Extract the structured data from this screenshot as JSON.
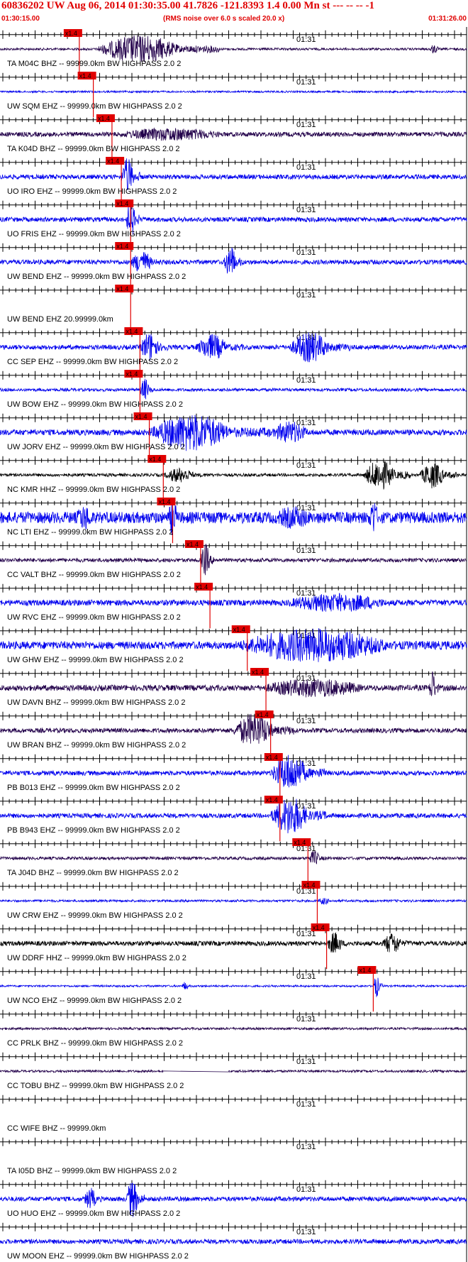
{
  "header": {
    "title": "60836202 UW Aug 06, 2014 01:30:35.00   41.7826 -121.8393  1.4 0.00 Mn st --- -- --  -1",
    "start_time": "01:30:15.00",
    "scale_note": "(RMS noise over 6.0 s scaled 20.0 x)",
    "end_time": "01:31:26.00"
  },
  "tick_label": "01:31",
  "pick_label": "x1.4",
  "colors": {
    "blue": "#0000ee",
    "navy": "#22004a",
    "black": "#000000",
    "red": "#e00000"
  },
  "traces": [
    {
      "label": "TA M04C BHZ -- 99999.0km BW  HIGHPASS  2.0  2",
      "color": "navy",
      "pick": 0.17,
      "amp": 0.06,
      "bursts": [
        [
          0.21,
          0.47,
          0.75
        ],
        [
          0.92,
          0.95,
          0.25
        ]
      ]
    },
    {
      "label": "UW SQM EHZ -- 99999.0km BW  HIGHPASS  2.0  2",
      "color": "blue",
      "pick": 0.2,
      "amp": 0.05,
      "bursts": []
    },
    {
      "label": "TA K04D BHZ -- 99999.0km BW  HIGHPASS  2.0  2",
      "color": "navy",
      "pick": 0.24,
      "amp": 0.12,
      "bursts": [
        [
          0.24,
          0.6,
          0.35
        ]
      ]
    },
    {
      "label": "UO IRO EHZ -- 99999.0km BW  HIGHPASS  2.0  2",
      "color": "blue",
      "pick": 0.26,
      "amp": 0.12,
      "bursts": [
        [
          0.26,
          0.3,
          1.0
        ]
      ]
    },
    {
      "label": "UO FRIS EHZ -- 99999.0km BW  HIGHPASS  2.0  2",
      "color": "blue",
      "pick": 0.28,
      "amp": 0.12,
      "bursts": [
        [
          0.27,
          0.3,
          1.0
        ]
      ]
    },
    {
      "label": "UW BEND EHZ -- 99999.0km BW  HIGHPASS  2.0  2",
      "color": "blue",
      "pick": 0.28,
      "amp": 0.12,
      "bursts": [
        [
          0.28,
          0.35,
          0.6
        ],
        [
          0.48,
          0.52,
          0.9
        ]
      ]
    },
    {
      "label": "UW BEND EHZ 20.99999.0km",
      "color": "none",
      "pick": 0.28,
      "amp": 0,
      "bursts": []
    },
    {
      "label": "CC SEP EHZ -- 99999.0km BW  HIGHPASS  2.0  2",
      "color": "blue",
      "pick": 0.3,
      "amp": 0.12,
      "bursts": [
        [
          0.3,
          0.36,
          0.8
        ],
        [
          0.42,
          0.52,
          0.7
        ],
        [
          0.62,
          0.75,
          0.8
        ]
      ]
    },
    {
      "label": "UW BOW EHZ -- 99999.0km BW  HIGHPASS  2.0  2",
      "color": "blue",
      "pick": 0.3,
      "amp": 0.08,
      "bursts": [
        [
          0.3,
          0.33,
          0.6
        ]
      ]
    },
    {
      "label": "UW JORV EHZ -- 99999.0km BW  HIGHPASS  2.0  2",
      "color": "blue",
      "pick": 0.32,
      "amp": 0.15,
      "bursts": [
        [
          0.32,
          0.58,
          1.0
        ],
        [
          0.58,
          0.7,
          0.6
        ]
      ]
    },
    {
      "label": "NC KMR HHZ -- 99999.0km BW  HIGHPASS  2.0  2",
      "color": "black",
      "pick": 0.35,
      "amp": 0.08,
      "bursts": [
        [
          0.35,
          0.45,
          0.4
        ],
        [
          0.78,
          0.88,
          0.8
        ],
        [
          0.9,
          0.98,
          0.7
        ]
      ]
    },
    {
      "label": "NC LTI EHZ -- 99999.0km BW  HIGHPASS  2.0  2",
      "color": "blue",
      "pick": 0.37,
      "amp": 0.3,
      "bursts": [
        [
          0.16,
          0.22,
          0.7
        ],
        [
          0.36,
          0.39,
          1.0
        ],
        [
          0.58,
          0.72,
          0.6
        ],
        [
          0.79,
          0.82,
          1.0
        ]
      ]
    },
    {
      "label": "CC VALT BHZ -- 99999.0km BW  HIGHPASS  2.0  2",
      "color": "navy",
      "pick": 0.43,
      "amp": 0.1,
      "bursts": [
        [
          0.43,
          0.46,
          0.9
        ]
      ]
    },
    {
      "label": "UW RVC EHZ -- 99999.0km BW  HIGHPASS  2.0  2",
      "color": "blue",
      "pick": 0.45,
      "amp": 0.15,
      "bursts": [
        [
          0.6,
          0.95,
          0.5
        ]
      ]
    },
    {
      "label": "UW GHW EHZ -- 99999.0km BW  HIGHPASS  2.0  2",
      "color": "blue",
      "pick": 0.53,
      "amp": 0.2,
      "bursts": [
        [
          0.5,
          1.0,
          0.9
        ]
      ]
    },
    {
      "label": "UW DAVN BHZ -- 99999.0km BW  HIGHPASS  2.0  2",
      "color": "navy",
      "pick": 0.57,
      "amp": 0.15,
      "bursts": [
        [
          0.55,
          0.9,
          0.5
        ],
        [
          0.92,
          0.94,
          1.0
        ]
      ]
    },
    {
      "label": "UW BRAN BHZ -- 99999.0km BW  HIGHPASS  2.0  2",
      "color": "navy",
      "pick": 0.58,
      "amp": 0.12,
      "bursts": [
        [
          0.5,
          0.63,
          0.9
        ]
      ]
    },
    {
      "label": "PB B013 EHZ -- 99999.0km BW  HIGHPASS  2.0  2",
      "color": "blue",
      "pick": 0.6,
      "amp": 0.12,
      "bursts": [
        [
          0.58,
          0.7,
          1.0
        ]
      ]
    },
    {
      "label": "PB B943 EHZ -- 99999.0km BW  HIGHPASS  2.0  2",
      "color": "blue",
      "pick": 0.6,
      "amp": 0.12,
      "bursts": [
        [
          0.58,
          0.7,
          1.0
        ]
      ]
    },
    {
      "label": "TA J04D BHZ -- 99999.0km BW  HIGHPASS  2.0  2",
      "color": "navy",
      "pick": 0.66,
      "amp": 0.08,
      "bursts": [
        [
          0.66,
          0.7,
          0.4
        ]
      ]
    },
    {
      "label": "UW CRW EHZ -- 99999.0km BW  HIGHPASS  2.0  2",
      "color": "blue",
      "pick": 0.68,
      "amp": 0.06,
      "bursts": [
        [
          0.68,
          0.72,
          0.2
        ]
      ]
    },
    {
      "label": "UW DDRF HHZ -- 99999.0km BW  HIGHPASS  2.0  2",
      "color": "black",
      "pick": 0.7,
      "amp": 0.12,
      "bursts": [
        [
          0.7,
          0.75,
          0.6
        ],
        [
          0.82,
          0.88,
          0.6
        ]
      ]
    },
    {
      "label": "UW NCO EHZ -- 99999.0km BW  HIGHPASS  2.0  2",
      "color": "blue",
      "pick": 0.8,
      "amp": 0.05,
      "bursts": [
        [
          0.8,
          0.82,
          0.6
        ],
        [
          0.39,
          0.41,
          0.25
        ]
      ]
    },
    {
      "label": "CC PRLK BHZ -- 99999.0km BW  HIGHPASS  2.0  2",
      "color": "navy",
      "pick": null,
      "amp": 0.06,
      "bursts": []
    },
    {
      "label": "CC TOBU BHZ -- 99999.0km BW  HIGHPASS  2.0  2",
      "color": "navy",
      "pick": null,
      "amp": 0.06,
      "bursts": [],
      "gap": [
        0.35,
        0.49
      ]
    },
    {
      "label": "CC WIFE BHZ -- 99999.0km",
      "color": "none",
      "pick": null,
      "amp": 0,
      "bursts": []
    },
    {
      "label": "TA I05D BHZ -- 99999.0km BW  HIGHPASS  2.0  2",
      "color": "none",
      "pick": null,
      "amp": 0,
      "bursts": []
    },
    {
      "label": "UO HUO EHZ -- 99999.0km BW  HIGHPASS  2.0  2",
      "color": "blue",
      "pick": null,
      "amp": 0.12,
      "bursts": [
        [
          0.18,
          0.22,
          0.6
        ],
        [
          0.27,
          0.31,
          1.0
        ]
      ]
    },
    {
      "label": "UW MOON EHZ -- 99999.0km BW  HIGHPASS  2.0  2",
      "color": "blue",
      "pick": null,
      "amp": 0.12,
      "bursts": []
    }
  ]
}
